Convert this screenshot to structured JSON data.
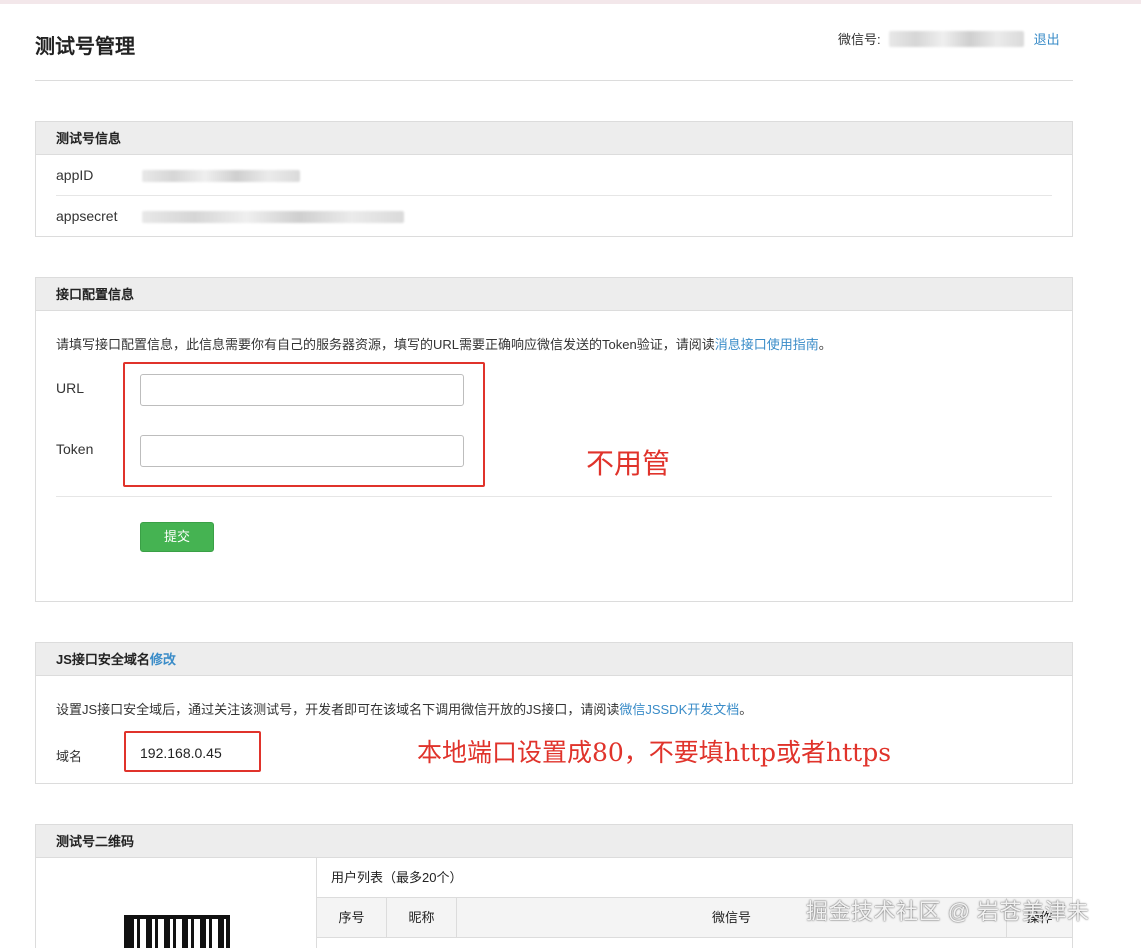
{
  "header": {
    "title": "测试号管理",
    "account_label": "微信号:",
    "logout_label": "退出"
  },
  "test_info": {
    "title": "测试号信息",
    "appid_label": "appID",
    "appsecret_label": "appsecret"
  },
  "interface_config": {
    "title": "接口配置信息",
    "description_prefix": "请填写接口配置信息，此信息需要你有自己的服务器资源，填写的URL需要正确响应微信发送的Token验证，请阅读",
    "description_link": "消息接口使用指南",
    "description_suffix": "。",
    "url_label": "URL",
    "url_value": "",
    "token_label": "Token",
    "token_value": "",
    "submit_label": "提交"
  },
  "js_domain": {
    "title": "JS接口安全域名",
    "edit_link": "修改",
    "description_prefix": "设置JS接口安全域后，通过关注该测试号，开发者即可在该域名下调用微信开放的JS接口，请阅读",
    "description_link": "微信JSSDK开发文档",
    "description_suffix": "。",
    "domain_label": "域名",
    "domain_value": "192.168.0.45"
  },
  "qrcode": {
    "title": "测试号二维码",
    "user_list_title": "用户列表（最多20个）",
    "columns": [
      "序号",
      "昵称",
      "微信号",
      "操作"
    ]
  },
  "annotations": {
    "config_note": "不用管",
    "domain_note": "本地端口设置成80，不要填http或者https"
  },
  "watermark": "掘金技术社区 @ 岩苍美津未",
  "colors": {
    "annotation_red": "#e0332b",
    "link_blue": "#3a8cc8",
    "submit_green": "#45b352"
  }
}
